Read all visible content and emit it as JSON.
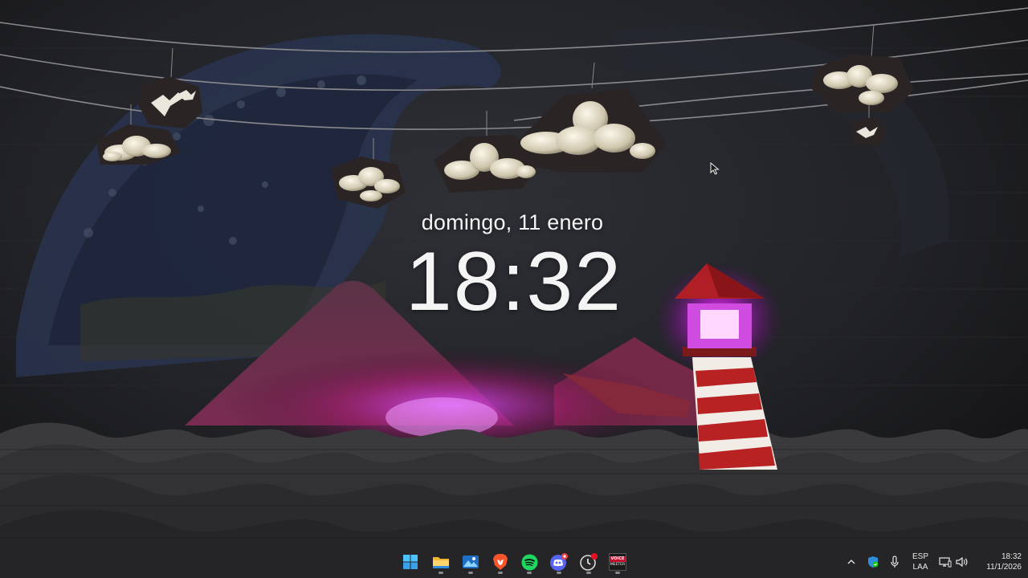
{
  "lock_screen": {
    "date": "domingo, 11 enero",
    "time": "18:32"
  },
  "wallpaper": {
    "scene_icons": [
      "wave",
      "clouds",
      "seagulls",
      "mountain",
      "lighthouse",
      "sea-waves"
    ],
    "colors": {
      "lamp_glow": "#d633ff",
      "lighthouse_red": "#b52121",
      "sea": "#2b2b2d"
    }
  },
  "taskbar": {
    "apps": [
      {
        "name": "start-button",
        "icon": "windows-logo-icon"
      },
      {
        "name": "file-explorer",
        "icon": "folder-icon"
      },
      {
        "name": "photos",
        "icon": "photos-icon"
      },
      {
        "name": "brave",
        "icon": "brave-lion-icon"
      },
      {
        "name": "spotify",
        "icon": "spotify-icon"
      },
      {
        "name": "discord",
        "icon": "discord-icon"
      },
      {
        "name": "alarm-clock",
        "icon": "clock-icon"
      },
      {
        "name": "voicemeeter",
        "icon": "voicemeeter-icon"
      }
    ],
    "voicemeeter_label_top": "VOICE",
    "voicemeeter_label_bottom": "MEETER",
    "tray": {
      "language_line1": "ESP",
      "language_line2": "LAA",
      "time": "18:32",
      "date": "11/1/2026"
    }
  }
}
